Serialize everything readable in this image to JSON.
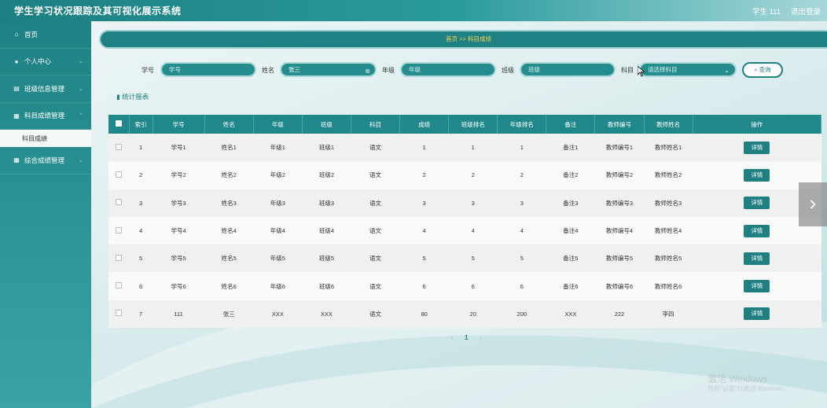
{
  "header": {
    "app_title": "学生学习状况跟踪及其可视化展示系统",
    "user": "学生 111",
    "logout": "退出登录"
  },
  "sidebar": {
    "items": [
      {
        "label": "首页",
        "icon": "home-icon"
      },
      {
        "label": "个人中心",
        "icon": "user-icon"
      },
      {
        "label": "班级信息管理",
        "icon": "list-icon"
      },
      {
        "label": "科目成绩管理",
        "icon": "grid-icon"
      },
      {
        "label": "综合成绩管理",
        "icon": "grid-icon"
      }
    ],
    "submenu_active": "科目成绩"
  },
  "breadcrumb": {
    "home": "首页",
    "sep": ">>",
    "current": "科目成绩"
  },
  "search": {
    "student_id_label": "学号",
    "student_id_placeholder": "学号",
    "name_label": "姓名",
    "name_value": "张三",
    "grade_label": "年级",
    "grade_placeholder": "年级",
    "class_label": "班级",
    "class_placeholder": "班级",
    "subject_label": "科目",
    "subject_placeholder": "请选择科目",
    "button": "查询"
  },
  "stats_link": "统计报表",
  "table": {
    "headers": [
      "索引",
      "学号",
      "姓名",
      "年级",
      "班级",
      "科目",
      "成绩",
      "班级排名",
      "年级排名",
      "备注",
      "教师编号",
      "教师姓名",
      "操作"
    ],
    "action_label": "详情",
    "rows": [
      [
        "1",
        "学号1",
        "姓名1",
        "年级1",
        "班级1",
        "语文",
        "1",
        "1",
        "1",
        "备注1",
        "教师编号1",
        "教师姓名1"
      ],
      [
        "2",
        "学号2",
        "姓名2",
        "年级2",
        "班级2",
        "语文",
        "2",
        "2",
        "2",
        "备注2",
        "教师编号2",
        "教师姓名2"
      ],
      [
        "3",
        "学号3",
        "姓名3",
        "年级3",
        "班级3",
        "语文",
        "3",
        "3",
        "3",
        "备注3",
        "教师编号3",
        "教师姓名3"
      ],
      [
        "4",
        "学号4",
        "姓名4",
        "年级4",
        "班级4",
        "语文",
        "4",
        "4",
        "4",
        "备注4",
        "教师编号4",
        "教师姓名4"
      ],
      [
        "5",
        "学号5",
        "姓名5",
        "年级5",
        "班级5",
        "语文",
        "5",
        "5",
        "5",
        "备注5",
        "教师编号5",
        "教师姓名5"
      ],
      [
        "6",
        "学号6",
        "姓名6",
        "年级6",
        "班级6",
        "语文",
        "6",
        "6",
        "6",
        "备注6",
        "教师编号6",
        "教师姓名6"
      ],
      [
        "7",
        "111",
        "张三",
        "XXX",
        "XXX",
        "语文",
        "80",
        "20",
        "200",
        "XXX",
        "222",
        "李四"
      ]
    ]
  },
  "pagination": {
    "prev": "‹",
    "current": "1",
    "next": "›"
  },
  "watermark": {
    "line1": "激活 Windows",
    "line2": "转到\"设置\"以激活 Windows。"
  },
  "colors": {
    "primary": "#1f8183",
    "accent_text": "#f5d64b"
  }
}
